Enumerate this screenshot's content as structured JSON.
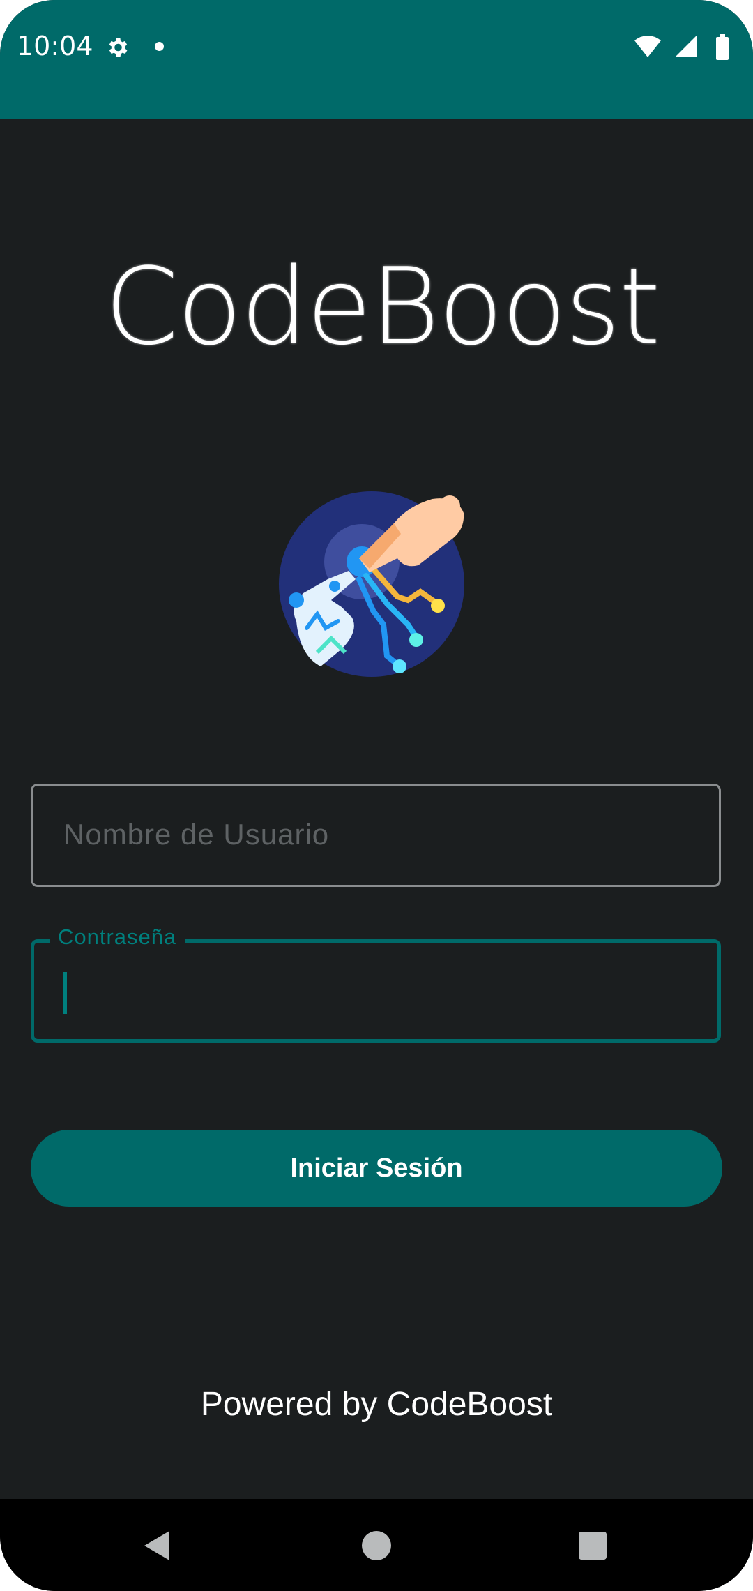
{
  "status_bar": {
    "time": "10:04",
    "icons": [
      "gear-icon",
      "notification-dot-icon",
      "wifi-icon",
      "signal-icon",
      "battery-icon"
    ]
  },
  "app": {
    "logo_text": "CodeBoost",
    "illustration_icon": "hand-touch-circuit-icon"
  },
  "login": {
    "username_placeholder": "Nombre de Usuario",
    "username_value": "",
    "password_label": "Contraseña",
    "password_value": "",
    "submit_label": "Iniciar Sesión"
  },
  "footer": {
    "text": "Powered by CodeBoost"
  },
  "nav": {
    "icons": [
      "back-icon",
      "home-icon",
      "recents-icon"
    ]
  },
  "colors": {
    "accent": "#006a69",
    "background": "#1b1e1f",
    "text": "#ffffff"
  }
}
